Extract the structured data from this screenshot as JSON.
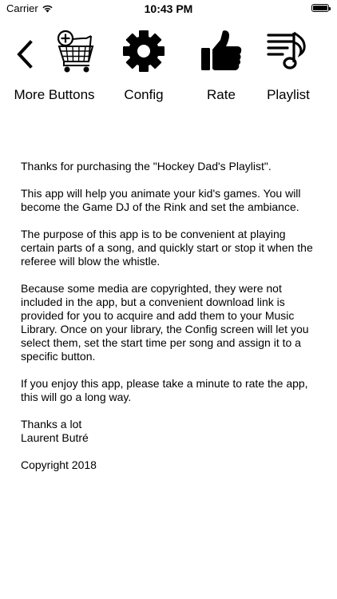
{
  "status_bar": {
    "carrier": "Carrier",
    "time": "10:43 PM",
    "battery_level": 1.0
  },
  "toolbar": {
    "back_icon": "chevron-left-icon",
    "items": [
      {
        "label": "More Buttons",
        "icon": "cart-add-icon"
      },
      {
        "label": "Config",
        "icon": "gear-icon"
      },
      {
        "label": "Rate",
        "icon": "thumbs-up-icon"
      },
      {
        "label": "Playlist",
        "icon": "music-playlist-icon"
      }
    ]
  },
  "content": {
    "paragraphs": [
      "Thanks for purchasing the \"Hockey Dad's Playlist\".",
      "This app will help you animate your kid's games. You will become the Game DJ of the Rink and set the ambiance.",
      "The purpose of this app is to be convenient at playing certain parts of a song, and quickly start or stop it when the referee will blow the whistle.",
      "Because some media are copyrighted, they were not included in the app, but a convenient download link is provided for you to acquire and add them to your Music Library. Once on your library, the Config screen will let you select them, set the start time per song and assign it to a specific button.",
      "If you enjoy this app, please take a minute to rate the app, this will go a long way."
    ],
    "signature_line1": "Thanks a lot",
    "signature_line2": "Laurent Butré",
    "copyright": "Copyright 2018"
  }
}
